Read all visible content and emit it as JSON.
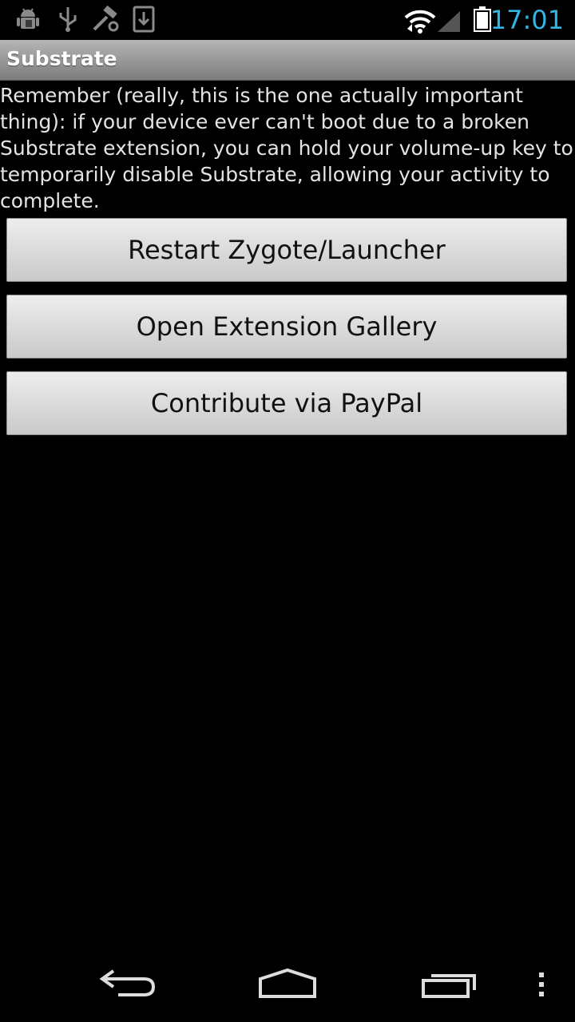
{
  "status_bar": {
    "time": "17:01",
    "left_icons": [
      "android-debug-icon",
      "usb-icon",
      "substrate-hammer-icon",
      "download-icon"
    ],
    "right_icons": [
      "wifi-icon",
      "signal-icon",
      "battery-icon"
    ],
    "accent_color": "#33b5e5"
  },
  "action_bar": {
    "title": "Substrate"
  },
  "main": {
    "message": "Remember (really, this is the one actually important thing): if your device ever can't boot due to a broken Substrate extension, you can hold your volume-up key to temporarily disable Substrate, allowing your activity to complete.",
    "buttons": [
      {
        "label": "Restart Zygote/Launcher"
      },
      {
        "label": "Open Extension Gallery"
      },
      {
        "label": "Contribute via PayPal"
      }
    ]
  },
  "nav_bar": {
    "icons": [
      "back-icon",
      "home-icon",
      "recent-apps-icon",
      "overflow-menu-icon"
    ]
  }
}
